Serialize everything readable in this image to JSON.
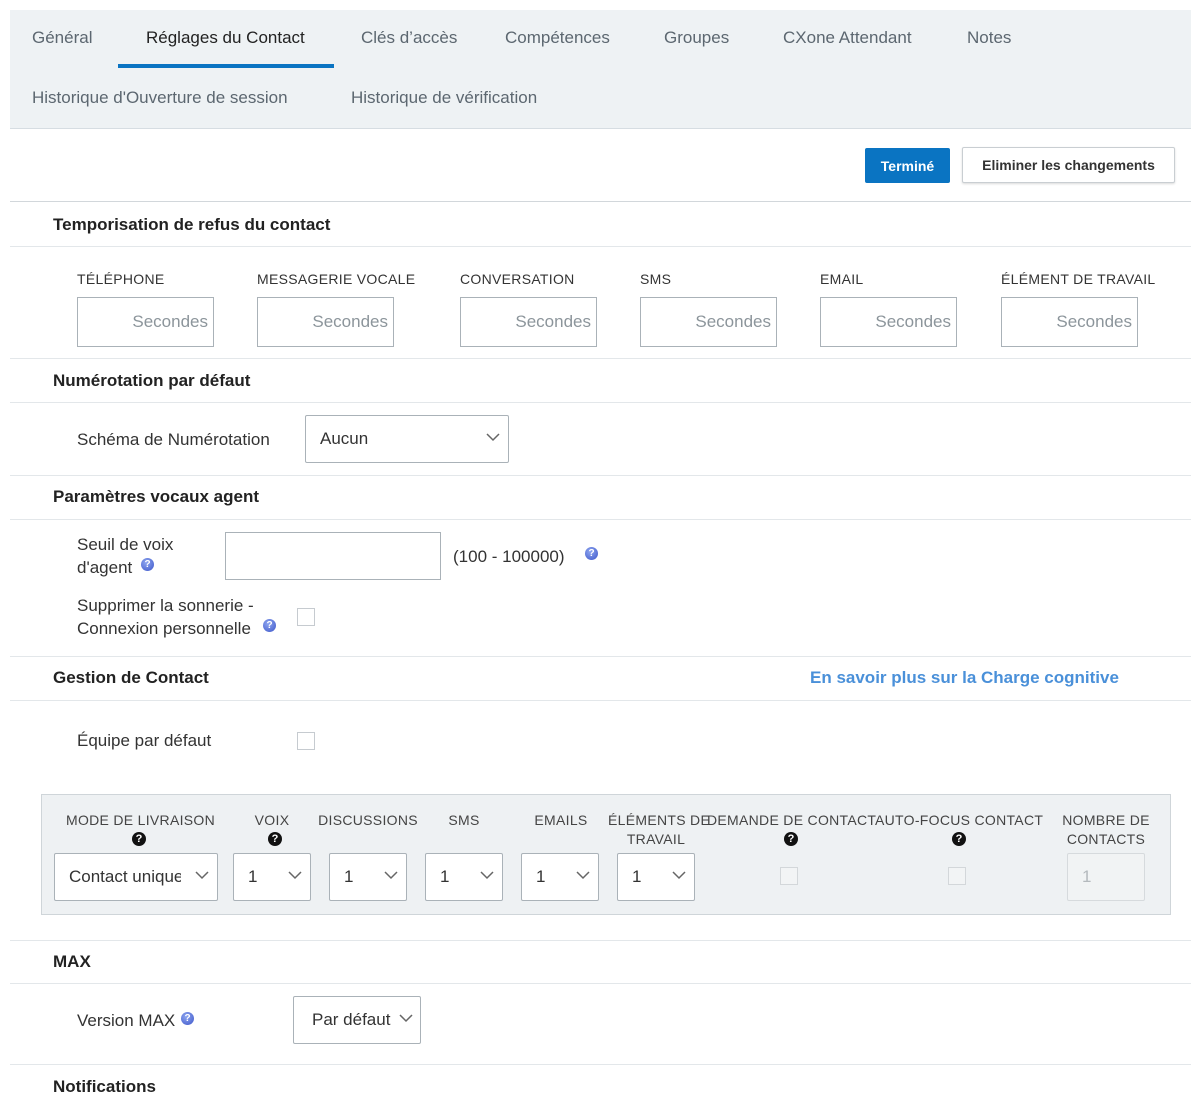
{
  "tabs": {
    "general": "Général",
    "contact_settings": "Réglages du Contact",
    "access_keys": "Clés d’accès",
    "skills": "Compétences",
    "groups": "Groupes",
    "cxone": "CXone Attendant",
    "notes": "Notes",
    "login_history": "Historique d'Ouverture de session",
    "audit_history": "Historique de vérification"
  },
  "toolbar": {
    "done": "Terminé",
    "discard": "Eliminer les changements"
  },
  "refusal": {
    "title": "Temporisation de refus du contact",
    "placeholder": "Secondes",
    "fields": [
      "TÉLÉPHONE",
      "MESSAGERIE VOCALE",
      "CONVERSATION",
      "SMS",
      "EMAIL",
      "ÉLÉMENT DE TRAVAIL"
    ]
  },
  "dialing": {
    "title": "Numérotation par défaut",
    "pattern_label": "Schéma de Numérotation",
    "pattern_value": "Aucun"
  },
  "voice": {
    "title": "Paramètres vocaux agent",
    "threshold_label_1": "Seuil de voix",
    "threshold_label_2": "d'agent",
    "range": "(100 - 100000)",
    "suppress_label_1": "Supprimer la sonnerie -",
    "suppress_label_2": "Connexion personnelle"
  },
  "contact_mgmt": {
    "title": "Gestion de Contact",
    "link": "En savoir plus sur la Charge cognitive",
    "default_team": "Équipe par défaut",
    "grid": {
      "delivery_mode": "MODE DE LIVRAISON",
      "voice": "VOIX",
      "discussions": "DISCUSSIONS",
      "sms": "SMS",
      "emails": "EMAILS",
      "work_items_1": "ÉLÉMENTS DE",
      "work_items_2": "TRAVAIL",
      "contact_request": "DEMANDE DE CONTACT",
      "autofocus": "AUTO-FOCUS CONTACT",
      "contacts_count_1": "NOMBRE DE",
      "contacts_count_2": "CONTACTS",
      "delivery_value": "Contact unique",
      "voice_value": "1",
      "discussions_value": "1",
      "sms_value": "1",
      "emails_value": "1",
      "work_items_value": "1",
      "contacts_count_value": "1"
    }
  },
  "max": {
    "title": "MAX",
    "version_label": "Version MAX",
    "version_value": "Par défaut"
  },
  "notifications": {
    "title": "Notifications"
  },
  "icons": {
    "help": "help-icon",
    "question": "question-icon",
    "chevron": "chevron-down-icon"
  },
  "colors": {
    "accent": "#0a74c2",
    "link": "#4a90d9"
  }
}
